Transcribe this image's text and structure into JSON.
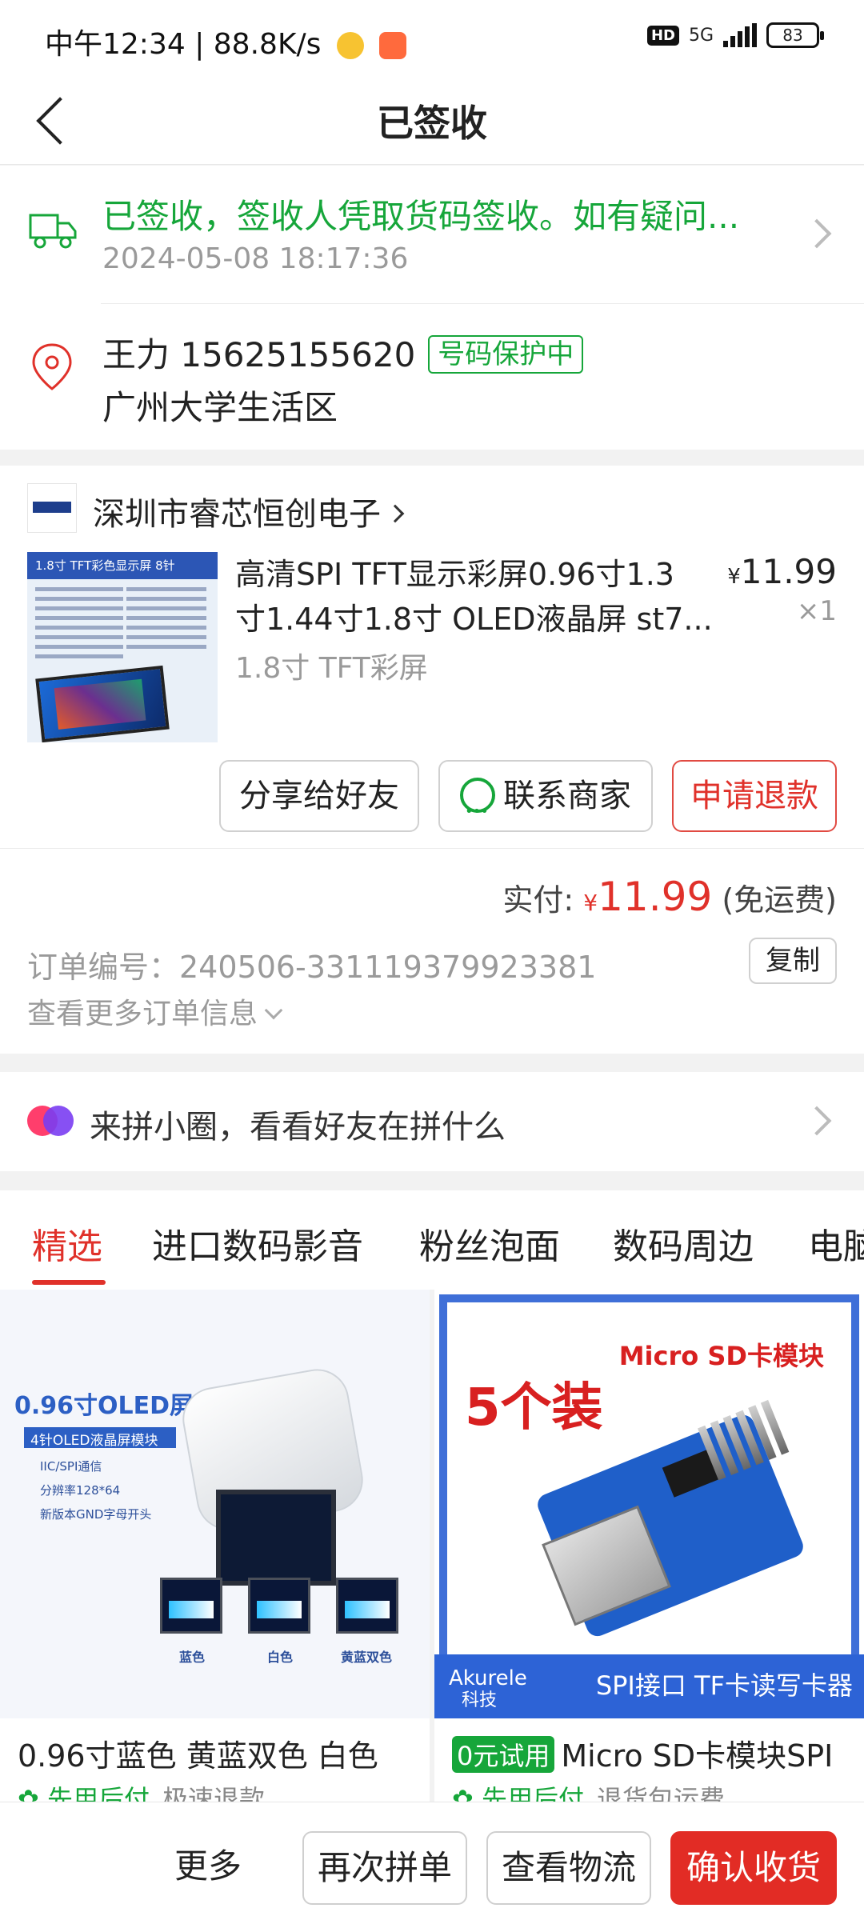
{
  "status_bar": {
    "time": "中午12:34",
    "speed": "88.8K/s",
    "hd": "HD",
    "network": "5G",
    "battery": "83"
  },
  "header": {
    "title": "已签收"
  },
  "logistics": {
    "status": "已签收，签收人凭取货码签收。如有疑问...",
    "time": "2024-05-08 18:17:36",
    "status_color": "#16a63a"
  },
  "address": {
    "name_phone": "王力  15625155620",
    "protect_badge": "号码保护中",
    "location": "广州大学生活区"
  },
  "shop": {
    "name": "深圳市睿芯恒创电子",
    "product": {
      "title": "高清SPI TFT显示彩屏0.96寸1.3寸1.44寸1.8寸 OLED液晶屏 st7...",
      "title_line1": "高清SPI TFT显示彩屏0.96寸1.3",
      "title_line2": "寸1.44寸1.8寸 OLED液晶屏 st7...",
      "spec": "1.8寸 TFT彩屏",
      "price_symbol": "¥",
      "price": "11.99",
      "qty": "×1",
      "thumb_label": "1.8寸 TFT彩色显示屏 8针"
    },
    "buttons": {
      "share": "分享给好友",
      "contact": "联系商家",
      "refund": "申请退款"
    },
    "paid_label": "实付:",
    "paid_symbol": "¥",
    "paid_amount": "11.99",
    "shipping_note": "(免运费)",
    "order_no": "订单编号：240506-331119379923381",
    "copy": "复制",
    "more_info": "查看更多订单信息"
  },
  "circle": {
    "text": "来拼小圈，看看好友在拼什么"
  },
  "tabs": [
    "精选",
    "进口数码影音",
    "粉丝泡面",
    "数码周边",
    "电脑"
  ],
  "feed": [
    {
      "title": "0.96寸蓝色 黄蓝双色 白色",
      "tag": "",
      "sub_green": "先用后付",
      "sub_gray": "极速退款",
      "image_text": {
        "title": "0.96寸OLED屏",
        "banner": "4针OLED液晶屏模块",
        "features": [
          "IIC/SPI通信",
          "分辨率128*64",
          "新版本GND字母开头"
        ],
        "labels": [
          "蓝色",
          "白色",
          "黄蓝双色"
        ]
      }
    },
    {
      "title": "Micro SD卡模块SPI",
      "tag": "0元试用",
      "sub_green": "先用后付",
      "sub_gray": "退货包运费",
      "image_text": {
        "headline": "Micro SD卡模块",
        "count": "5个装",
        "brand": "Akurele",
        "brand_sub": "科技",
        "interface": "SPI接口 TF卡读写卡器"
      }
    }
  ],
  "bottom_bar": {
    "more": "更多",
    "reorder": "再次拼单",
    "track": "查看物流",
    "confirm": "确认收货"
  },
  "colors": {
    "accent_red": "#e0312a",
    "green": "#16a63a",
    "primary_button": "#e22c25"
  }
}
